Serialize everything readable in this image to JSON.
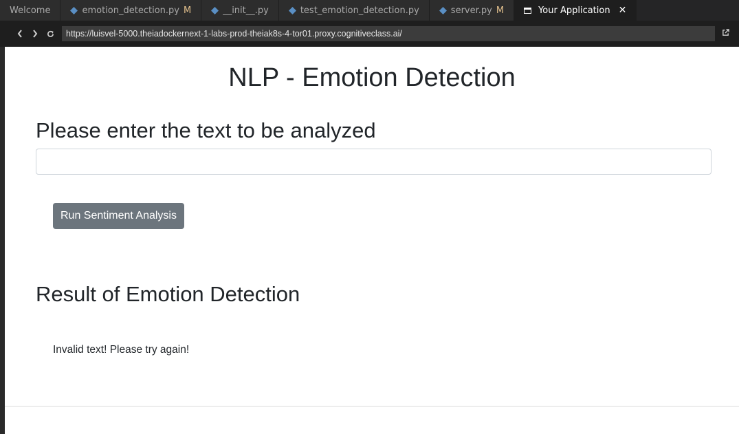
{
  "tabs": [
    {
      "label": "Welcome",
      "icon": "none",
      "modified": ""
    },
    {
      "label": "emotion_detection.py",
      "icon": "python-icon",
      "modified": "M"
    },
    {
      "label": "__init__.py",
      "icon": "python-icon",
      "modified": ""
    },
    {
      "label": "test_emotion_detection.py",
      "icon": "python-icon",
      "modified": ""
    },
    {
      "label": "server.py",
      "icon": "python-icon",
      "modified": "M"
    },
    {
      "label": "Your Application",
      "icon": "window-icon",
      "modified": "",
      "close": "✕"
    }
  ],
  "browser": {
    "url": "https://luisvel-5000.theiadockernext-1-labs-prod-theiak8s-4-tor01.proxy.cognitiveclass.ai/"
  },
  "page": {
    "title": "NLP - Emotion Detection",
    "prompt": "Please enter the text to be analyzed",
    "input_value": "",
    "input_placeholder": "",
    "button_label": "Run Sentiment Analysis",
    "result_heading": "Result of Emotion Detection",
    "result_text": "Invalid text! Please try again!"
  },
  "colors": {
    "button_bg": "#6c757d",
    "modified_marker": "#e2c08d",
    "python_icon": "#5a8fc4"
  }
}
